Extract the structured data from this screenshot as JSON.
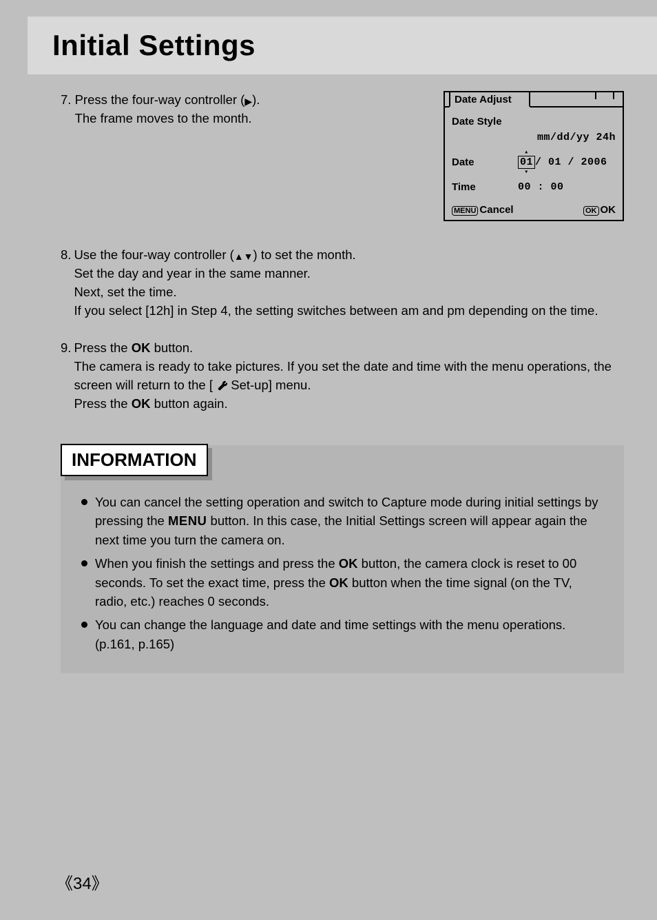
{
  "title": "Initial Settings",
  "step7": {
    "num": "7.",
    "line1": "Press the four-way controller (",
    "line1_end": ").",
    "line2": "The frame moves to the month."
  },
  "lcd": {
    "tab": "Date Adjust",
    "row_style_label": "Date Style",
    "row_style_value": "mm/dd/yy",
    "row_style_suffix": "24h",
    "row_date_label": "Date",
    "row_date_seg": "01",
    "row_date_rest": "/ 01 / 2006",
    "row_time_label": "Time",
    "row_time_value": "00 : 00",
    "footer_menu": "MENU",
    "footer_cancel": "Cancel",
    "footer_ok_badge": "OK",
    "footer_ok": "OK"
  },
  "step8": {
    "num": "8.",
    "line1a": "Use the four-way controller (",
    "line1b": ") to set the month.",
    "line2": "Set the day and year in the same manner.",
    "line3": "Next, set the time.",
    "line4": "If you select [12h] in Step 4, the setting switches between am and pm depending on the time."
  },
  "step9": {
    "num": "9.",
    "line1a": "Press the ",
    "line1b": " button.",
    "line2a": "The camera is ready to take pictures. If you set the date and time with the menu operations, the screen will return to the [ ",
    "line2b": " Set-up] menu.",
    "line3a": "Press the ",
    "line3b": " button again."
  },
  "glyph": {
    "ok": "OK",
    "menu": "MENU"
  },
  "info": {
    "header": "INFORMATION",
    "b1a": "You can cancel the setting operation and switch to Capture mode during initial settings by pressing the ",
    "b1b": " button. In this case, the Initial Settings screen will appear again the next time you turn the camera on.",
    "b2a": "When you finish the settings and press the ",
    "b2b": " button, the camera clock is reset to 00 seconds. To set the exact time, press the ",
    "b2c": " button when the time signal (on the TV, radio, etc.) reaches 0 seconds.",
    "b3": "You can change the language and date and time settings with the menu operations. (p.161, p.165)"
  },
  "page_number": "34"
}
